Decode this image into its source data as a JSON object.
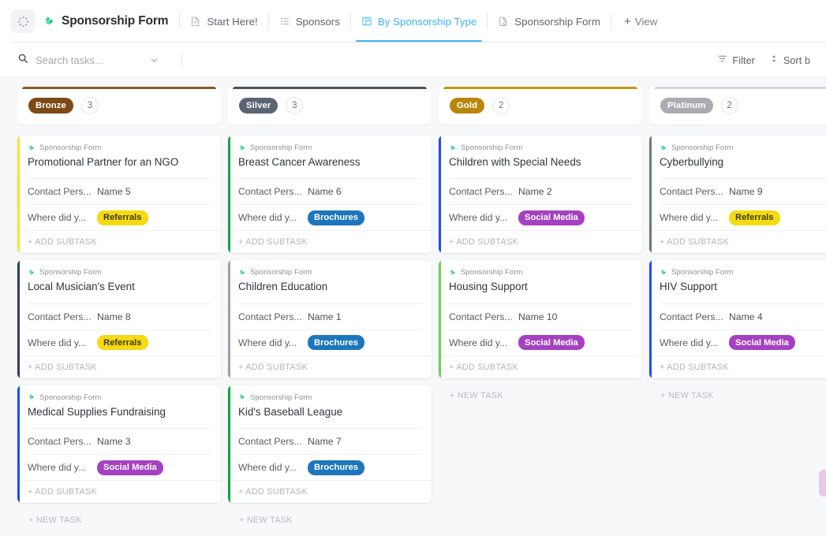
{
  "header": {
    "spinner_icon": "loading-spinner-icon",
    "doc_icon": "clickup-form-diamond-icon",
    "title": "Sponsorship Form",
    "tabs": [
      {
        "label": "Start Here!",
        "icon": "doc-icon",
        "active": false
      },
      {
        "label": "Sponsors",
        "icon": "list-icon",
        "active": false
      },
      {
        "label": "By Sponsorship Type",
        "icon": "board-icon",
        "active": true
      },
      {
        "label": "Sponsorship Form",
        "icon": "form-icon",
        "active": false
      }
    ],
    "add_view_label": "View",
    "add_view_plus": "+"
  },
  "toolbar": {
    "search_placeholder": "Search tasks...",
    "search_value": "",
    "search_icon": "search-icon",
    "chevron_icon": "chevron-down-icon",
    "filter_label": "Filter",
    "filter_icon": "filter-icon",
    "sort_label": "Sort b",
    "sort_icon": "sort-icon"
  },
  "board": {
    "add_subtask_label": "+ ADD SUBTASK",
    "new_task_label": "+ NEW TASK",
    "breadcrumb_label": "Sponsorship Form",
    "columns": [
      {
        "name": "Bronze",
        "count": "3",
        "pill_color": "#7c4a17",
        "top_line_color": "#8a5a25",
        "show_new_task": true,
        "cards": [
          {
            "title": "Promotional Partner for an NGO",
            "accent": "#f5e431",
            "contact_label": "Contact Pers...",
            "contact_value": "Name 5",
            "source_label": "Where did y...",
            "source_value": "Referrals",
            "source_color": "#f5d913",
            "source_text_color": "#3d3d00"
          },
          {
            "title": "Local Musician's Event",
            "accent": "#2f3f5c",
            "contact_label": "Contact Pers...",
            "contact_value": "Name 8",
            "source_label": "Where did y...",
            "source_value": "Referrals",
            "source_color": "#f5d913",
            "source_text_color": "#3d3d00"
          },
          {
            "title": "Medical Supplies Fundraising",
            "accent": "#1f4df5",
            "contact_label": "Contact Pers...",
            "contact_value": "Name 3",
            "source_label": "Where did y...",
            "source_value": "Social Media",
            "source_color": "#a541c1",
            "source_text_color": "#ffffff"
          }
        ]
      },
      {
        "name": "Silver",
        "count": "3",
        "pill_color": "#5a6472",
        "top_line_color": "#4a5260",
        "show_new_task": true,
        "cards": [
          {
            "title": "Breast Cancer Awareness",
            "accent": "#14a44a",
            "contact_label": "Contact Pers...",
            "contact_value": "Name 6",
            "source_label": "Where did y...",
            "source_value": "Brochures",
            "source_color": "#1d76bd",
            "source_text_color": "#ffffff"
          },
          {
            "title": "Children Education",
            "accent": "#9ba2ab",
            "contact_label": "Contact Pers...",
            "contact_value": "Name 1",
            "source_label": "Where did y...",
            "source_value": "Brochures",
            "source_color": "#1d76bd",
            "source_text_color": "#ffffff"
          },
          {
            "title": "Kid's Baseball League",
            "accent": "#0da53f",
            "contact_label": "Contact Pers...",
            "contact_value": "Name 7",
            "source_label": "Where did y...",
            "source_value": "Brochures",
            "source_color": "#1d76bd",
            "source_text_color": "#ffffff"
          }
        ]
      },
      {
        "name": "Gold",
        "count": "2",
        "pill_color": "#b8860b",
        "top_line_color": "#c9970d",
        "show_new_task": true,
        "cards": [
          {
            "title": "Children with Special Needs",
            "accent": "#1f4df5",
            "contact_label": "Contact Pers...",
            "contact_value": "Name 2",
            "source_label": "Where did y...",
            "source_value": "Social Media",
            "source_color": "#a541c1",
            "source_text_color": "#ffffff"
          },
          {
            "title": "Housing Support",
            "accent": "#6fce5a",
            "contact_label": "Contact Pers...",
            "contact_value": "Name 10",
            "source_label": "Where did y...",
            "source_value": "Social Media",
            "source_color": "#a541c1",
            "source_text_color": "#ffffff"
          }
        ]
      },
      {
        "name": "Platinum",
        "count": "2",
        "pill_color": "#a9acb3",
        "top_line_color": "#d4d7dc",
        "show_new_task": true,
        "cards": [
          {
            "title": "Cyberbullying",
            "accent": "#6b7b73",
            "contact_label": "Contact Pers...",
            "contact_value": "Name 9",
            "source_label": "Where did y...",
            "source_value": "Referrals",
            "source_color": "#f5d913",
            "source_text_color": "#3d3d00"
          },
          {
            "title": "HIV Support",
            "accent": "#1f4df5",
            "contact_label": "Contact Pers...",
            "contact_value": "Name 4",
            "source_label": "Where did y...",
            "source_value": "Social Media",
            "source_color": "#a541c1",
            "source_text_color": "#ffffff"
          }
        ]
      }
    ]
  }
}
